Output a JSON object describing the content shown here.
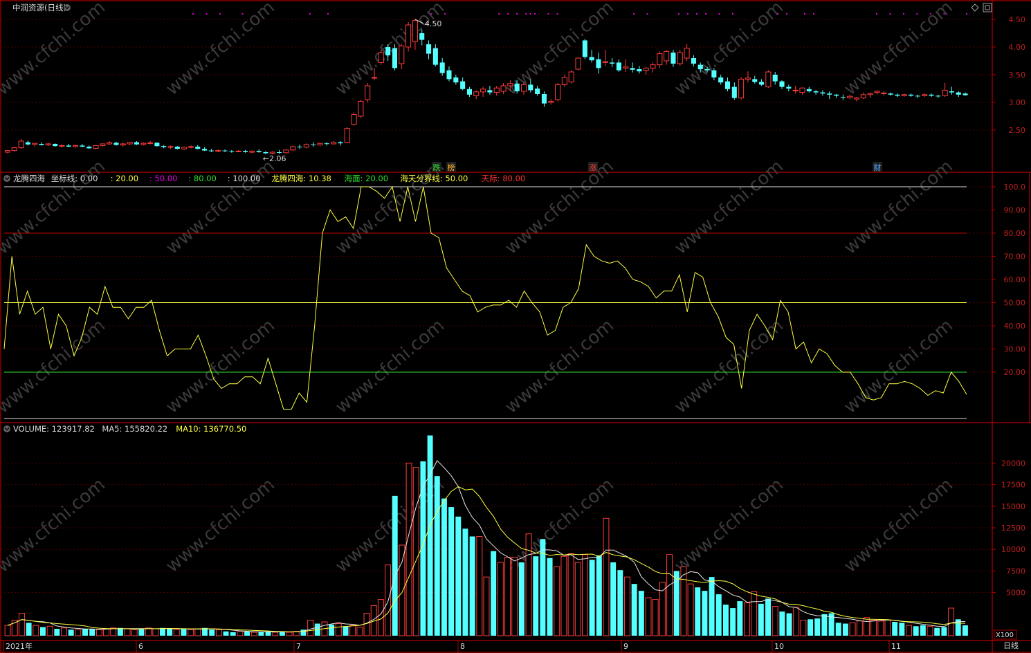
{
  "colors": {
    "up": "#ff3c3c",
    "down": "#54ffff",
    "frame": "#b00000",
    "yellow": "#ffff40",
    "green": "#2ee02e",
    "white": "#dcdcdc",
    "red_line": "#c00000",
    "magenta": "#e000e0",
    "grid": "#500000"
  },
  "title": "中润资源(日线)",
  "watermark": "www.cfchi.com",
  "price_panel": {
    "y_ticks": [
      "4.50",
      "4.00",
      "3.50",
      "3.00",
      "2.50"
    ],
    "max_label": "4.50",
    "min_label": "2.06",
    "markers": [
      "跌",
      "榜",
      "涨",
      "财"
    ]
  },
  "indicator_panel": {
    "header": [
      {
        "text": "龙腾四海",
        "color": "#dcdcdc"
      },
      {
        "text": "坐标线: 0.00",
        "color": "#dcdcdc"
      },
      {
        "text": ": 20.00",
        "color": "#ffff40"
      },
      {
        "text": ": 50.00",
        "color": "#e000e0"
      },
      {
        "text": ": 80.00",
        "color": "#2ee02e"
      },
      {
        "text": ": 100.00",
        "color": "#dcdcdc"
      },
      {
        "text": "龙腾四海: 10.38",
        "color": "#ffff40"
      },
      {
        "text": "海面: 20.00",
        "color": "#2ee02e"
      },
      {
        "text": "海天分界线: 50.00",
        "color": "#ffff40"
      },
      {
        "text": "天际: 80.00",
        "color": "#ff3030"
      }
    ],
    "y_ticks": [
      "100.0",
      "90.00",
      "80.00",
      "70.00",
      "60.00",
      "50.00",
      "40.00",
      "30.00",
      "20.00"
    ]
  },
  "volume_panel": {
    "header": [
      {
        "text": "VOLUME: 123917.82",
        "color": "#dcdcdc"
      },
      {
        "text": "MA5: 155820.22",
        "color": "#dcdcdc"
      },
      {
        "text": "MA10: 136770.50",
        "color": "#ffff40"
      }
    ],
    "y_ticks": [
      "20000",
      "17500",
      "15000",
      "12500",
      "10000",
      "7500",
      "5000"
    ],
    "unit": "X100"
  },
  "x_axis": {
    "labels": [
      "2021年",
      "6",
      "7",
      "8",
      "9",
      "10",
      "11"
    ],
    "period": "日线"
  },
  "chart_data": [
    {
      "type": "candlestick",
      "title": "中润资源(日线)",
      "ylim": [
        2.0,
        4.6
      ],
      "ohlc": [
        [
          2.1,
          2.14,
          2.08,
          2.13
        ],
        [
          2.13,
          2.2,
          2.11,
          2.18
        ],
        [
          2.18,
          2.34,
          2.16,
          2.3
        ],
        [
          2.28,
          2.31,
          2.22,
          2.24
        ],
        [
          2.24,
          2.27,
          2.2,
          2.26
        ],
        [
          2.25,
          2.28,
          2.22,
          2.23
        ],
        [
          2.23,
          2.27,
          2.21,
          2.25
        ],
        [
          2.25,
          2.26,
          2.2,
          2.21
        ],
        [
          2.21,
          2.24,
          2.18,
          2.22
        ],
        [
          2.22,
          2.25,
          2.19,
          2.2
        ],
        [
          2.2,
          2.24,
          2.18,
          2.22
        ],
        [
          2.22,
          2.25,
          2.19,
          2.2
        ],
        [
          2.2,
          2.22,
          2.16,
          2.17
        ],
        [
          2.17,
          2.23,
          2.15,
          2.22
        ],
        [
          2.22,
          2.26,
          2.2,
          2.25
        ],
        [
          2.25,
          2.3,
          2.23,
          2.27
        ],
        [
          2.27,
          2.29,
          2.22,
          2.23
        ],
        [
          2.23,
          2.27,
          2.2,
          2.25
        ],
        [
          2.25,
          2.29,
          2.23,
          2.28
        ],
        [
          2.28,
          2.3,
          2.23,
          2.24
        ],
        [
          2.24,
          2.28,
          2.22,
          2.26
        ],
        [
          2.26,
          2.3,
          2.24,
          2.27
        ],
        [
          2.27,
          2.28,
          2.2,
          2.21
        ],
        [
          2.21,
          2.23,
          2.17,
          2.19
        ],
        [
          2.19,
          2.22,
          2.16,
          2.2
        ],
        [
          2.2,
          2.21,
          2.15,
          2.16
        ],
        [
          2.16,
          2.2,
          2.14,
          2.19
        ],
        [
          2.19,
          2.22,
          2.17,
          2.2
        ],
        [
          2.2,
          2.23,
          2.15,
          2.16
        ],
        [
          2.16,
          2.19,
          2.12,
          2.13
        ],
        [
          2.13,
          2.16,
          2.1,
          2.12
        ],
        [
          2.12,
          2.15,
          2.1,
          2.13
        ],
        [
          2.13,
          2.15,
          2.1,
          2.12
        ],
        [
          2.12,
          2.14,
          2.09,
          2.11
        ],
        [
          2.11,
          2.14,
          2.1,
          2.12
        ],
        [
          2.12,
          2.14,
          2.09,
          2.1
        ],
        [
          2.1,
          2.13,
          2.08,
          2.12
        ],
        [
          2.12,
          2.15,
          2.09,
          2.1
        ],
        [
          2.1,
          2.12,
          2.07,
          2.08
        ],
        [
          2.08,
          2.12,
          2.06,
          2.1
        ],
        [
          2.1,
          2.14,
          2.07,
          2.09
        ],
        [
          2.09,
          2.15,
          2.08,
          2.14
        ],
        [
          2.14,
          2.22,
          2.12,
          2.2
        ],
        [
          2.2,
          2.24,
          2.16,
          2.19
        ],
        [
          2.19,
          2.26,
          2.17,
          2.24
        ],
        [
          2.24,
          2.28,
          2.2,
          2.23
        ],
        [
          2.23,
          2.27,
          2.21,
          2.26
        ],
        [
          2.26,
          2.28,
          2.22,
          2.25
        ],
        [
          2.25,
          2.3,
          2.24,
          2.28
        ],
        [
          2.28,
          2.3,
          2.22,
          2.26
        ],
        [
          2.27,
          2.55,
          2.26,
          2.53
        ],
        [
          2.6,
          2.82,
          2.58,
          2.78
        ],
        [
          2.75,
          3.05,
          2.72,
          3.02
        ],
        [
          3.05,
          3.35,
          3.0,
          3.3
        ],
        [
          3.45,
          3.62,
          3.4,
          3.45
        ],
        [
          3.72,
          3.95,
          3.68,
          3.9
        ],
        [
          4.0,
          4.05,
          3.75,
          3.85
        ],
        [
          3.98,
          4.05,
          3.58,
          3.62
        ],
        [
          3.7,
          4.05,
          3.6,
          4.02
        ],
        [
          4.0,
          4.45,
          3.92,
          4.4
        ],
        [
          4.1,
          4.5,
          3.95,
          4.48
        ],
        [
          4.25,
          4.32,
          4.03,
          4.13
        ],
        [
          4.05,
          4.12,
          3.78,
          3.88
        ],
        [
          3.98,
          4.05,
          3.65,
          3.68
        ],
        [
          3.72,
          3.8,
          3.48,
          3.53
        ],
        [
          3.58,
          3.65,
          3.38,
          3.42
        ],
        [
          3.45,
          3.5,
          3.32,
          3.36
        ],
        [
          3.38,
          3.45,
          3.22,
          3.24
        ],
        [
          3.24,
          3.28,
          3.1,
          3.14
        ],
        [
          3.12,
          3.22,
          3.06,
          3.19
        ],
        [
          3.19,
          3.28,
          3.1,
          3.24
        ],
        [
          3.22,
          3.3,
          3.14,
          3.18
        ],
        [
          3.18,
          3.3,
          3.12,
          3.26
        ],
        [
          3.2,
          3.35,
          3.15,
          3.3
        ],
        [
          3.3,
          3.4,
          3.2,
          3.34
        ],
        [
          3.34,
          3.4,
          3.16,
          3.2
        ],
        [
          3.2,
          3.36,
          3.14,
          3.32
        ],
        [
          3.32,
          3.42,
          3.18,
          3.22
        ],
        [
          3.25,
          3.3,
          3.12,
          3.15
        ],
        [
          3.15,
          3.2,
          2.92,
          2.98
        ],
        [
          3.0,
          3.06,
          2.96,
          3.02
        ],
        [
          3.05,
          3.35,
          3.02,
          3.32
        ],
        [
          3.32,
          3.5,
          3.28,
          3.45
        ],
        [
          3.37,
          3.58,
          3.34,
          3.55
        ],
        [
          3.6,
          3.82,
          3.58,
          3.8
        ],
        [
          4.12,
          4.15,
          3.78,
          3.82
        ],
        [
          3.82,
          3.95,
          3.72,
          3.76
        ],
        [
          3.78,
          3.9,
          3.52,
          3.62
        ],
        [
          3.72,
          3.95,
          3.66,
          3.74
        ],
        [
          3.72,
          3.8,
          3.64,
          3.7
        ],
        [
          3.72,
          3.78,
          3.55,
          3.58
        ],
        [
          3.62,
          3.78,
          3.55,
          3.64
        ],
        [
          3.62,
          3.72,
          3.54,
          3.59
        ],
        [
          3.6,
          3.66,
          3.52,
          3.56
        ],
        [
          3.58,
          3.64,
          3.5,
          3.62
        ],
        [
          3.62,
          3.72,
          3.54,
          3.68
        ],
        [
          3.68,
          3.92,
          3.62,
          3.88
        ],
        [
          3.75,
          3.95,
          3.68,
          3.92
        ],
        [
          3.9,
          3.95,
          3.64,
          3.7
        ],
        [
          3.7,
          3.95,
          3.66,
          3.9
        ],
        [
          3.8,
          4.05,
          3.75,
          3.98
        ],
        [
          3.8,
          3.85,
          3.65,
          3.7
        ],
        [
          3.68,
          3.72,
          3.54,
          3.6
        ],
        [
          3.6,
          3.64,
          3.54,
          3.58
        ],
        [
          3.58,
          3.62,
          3.4,
          3.45
        ],
        [
          3.45,
          3.5,
          3.32,
          3.36
        ],
        [
          3.38,
          3.45,
          3.2,
          3.24
        ],
        [
          3.28,
          3.36,
          3.05,
          3.08
        ],
        [
          3.08,
          3.46,
          3.05,
          3.42
        ],
        [
          3.42,
          3.56,
          3.36,
          3.44
        ],
        [
          3.42,
          3.48,
          3.34,
          3.37
        ],
        [
          3.37,
          3.42,
          3.3,
          3.32
        ],
        [
          3.28,
          3.58,
          3.26,
          3.55
        ],
        [
          3.5,
          3.55,
          3.32,
          3.38
        ],
        [
          3.38,
          3.4,
          3.24,
          3.28
        ],
        [
          3.28,
          3.32,
          3.2,
          3.25
        ],
        [
          3.22,
          3.3,
          3.16,
          3.22
        ],
        [
          3.18,
          3.27,
          3.14,
          3.26
        ],
        [
          3.24,
          3.28,
          3.18,
          3.2
        ],
        [
          3.2,
          3.22,
          3.14,
          3.18
        ],
        [
          3.18,
          3.22,
          3.12,
          3.16
        ],
        [
          3.16,
          3.2,
          3.06,
          3.14
        ],
        [
          3.14,
          3.15,
          3.08,
          3.12
        ],
        [
          3.1,
          3.14,
          3.04,
          3.09
        ],
        [
          3.08,
          3.14,
          3.06,
          3.11
        ],
        [
          3.06,
          3.1,
          3.02,
          3.08
        ],
        [
          3.08,
          3.18,
          3.06,
          3.14
        ],
        [
          3.14,
          3.18,
          3.08,
          3.16
        ],
        [
          3.18,
          3.22,
          3.14,
          3.2
        ],
        [
          3.16,
          3.2,
          3.12,
          3.17
        ],
        [
          3.16,
          3.18,
          3.12,
          3.14
        ],
        [
          3.14,
          3.16,
          3.1,
          3.12
        ],
        [
          3.12,
          3.16,
          3.1,
          3.14
        ],
        [
          3.14,
          3.16,
          3.1,
          3.12
        ],
        [
          3.12,
          3.14,
          3.08,
          3.11
        ],
        [
          3.12,
          3.16,
          3.1,
          3.14
        ],
        [
          3.14,
          3.16,
          3.1,
          3.12
        ],
        [
          3.12,
          3.14,
          3.08,
          3.11
        ],
        [
          3.12,
          3.35,
          3.1,
          3.22
        ],
        [
          3.2,
          3.28,
          3.14,
          3.18
        ],
        [
          3.18,
          3.2,
          3.1,
          3.14
        ],
        [
          3.16,
          3.18,
          3.12,
          3.13
        ]
      ]
    },
    {
      "type": "line",
      "title": "龙腾四海",
      "ylim": [
        0,
        100
      ],
      "series": [
        {
          "name": "龙腾四海",
          "values": [
            30,
            70,
            45,
            55,
            45,
            48,
            30,
            45,
            40,
            27,
            35,
            48,
            45,
            57,
            48,
            48,
            43,
            48,
            48,
            51,
            38,
            27,
            30,
            30,
            30,
            36,
            27,
            17,
            13,
            15,
            15,
            18,
            18,
            15,
            26,
            15,
            4,
            4,
            11,
            7,
            40,
            80,
            90,
            85,
            87,
            82,
            100,
            100,
            98,
            95,
            100,
            85,
            100,
            85,
            100,
            80,
            78,
            65,
            60,
            55,
            53,
            46,
            48,
            49,
            49,
            51,
            48,
            55,
            50,
            46,
            36,
            38,
            48,
            50,
            56,
            75,
            70,
            68,
            67,
            68,
            65,
            60,
            59,
            57,
            52,
            55,
            55,
            62,
            46,
            63,
            61,
            50,
            44,
            35,
            32,
            13,
            38,
            45,
            40,
            34,
            51,
            46,
            30,
            33,
            24,
            30,
            28,
            23,
            20,
            20,
            15,
            9,
            8,
            9,
            15,
            15,
            16,
            15,
            13,
            10,
            12,
            11,
            20,
            16,
            10.38
          ]
        },
        {
          "name": "海面",
          "values": [
            20
          ]
        },
        {
          "name": "海天分界线",
          "values": [
            50
          ]
        },
        {
          "name": "天际",
          "values": [
            80
          ]
        }
      ]
    },
    {
      "type": "bar",
      "title": "VOLUME",
      "ylim": [
        0,
        23000
      ],
      "unit": "X100",
      "values": [
        1200,
        1800,
        2600,
        1500,
        1200,
        1000,
        1100,
        800,
        900,
        700,
        700,
        800,
        800,
        700,
        800,
        900,
        900,
        800,
        700,
        800,
        900,
        800,
        900,
        800,
        700,
        800,
        700,
        800,
        900,
        700,
        700,
        500,
        400,
        500,
        500,
        400,
        400,
        500,
        400,
        500,
        400,
        500,
        700,
        1800,
        1400,
        1600,
        1300,
        1400,
        1100,
        1200,
        1000,
        2600,
        3500,
        4200,
        8200,
        16200,
        10500,
        20000,
        19500,
        20200,
        23200,
        18500,
        15900,
        14900,
        13800,
        12400,
        11500,
        11500,
        6800,
        9800,
        8500,
        9100,
        9100,
        8500,
        11800,
        9200,
        11200,
        9000,
        8000,
        9200,
        9500,
        8500,
        9400,
        8800,
        9300,
        13600,
        8500,
        7600,
        6800,
        6000,
        5200,
        4400,
        4200,
        6200,
        9400,
        7500,
        8000,
        6000,
        5600,
        5200,
        6800,
        4800,
        3600,
        3200,
        4000,
        3800,
        5100,
        3700,
        4300,
        3400,
        2800,
        2600,
        3300,
        1800,
        1900,
        2000,
        2500,
        2600,
        1500,
        1400,
        1500,
        1700,
        2100,
        1800,
        1700,
        1800,
        1600,
        1500,
        1200,
        1100,
        1200,
        1100,
        900,
        1000,
        3200,
        1900,
        1200
      ]
    }
  ]
}
